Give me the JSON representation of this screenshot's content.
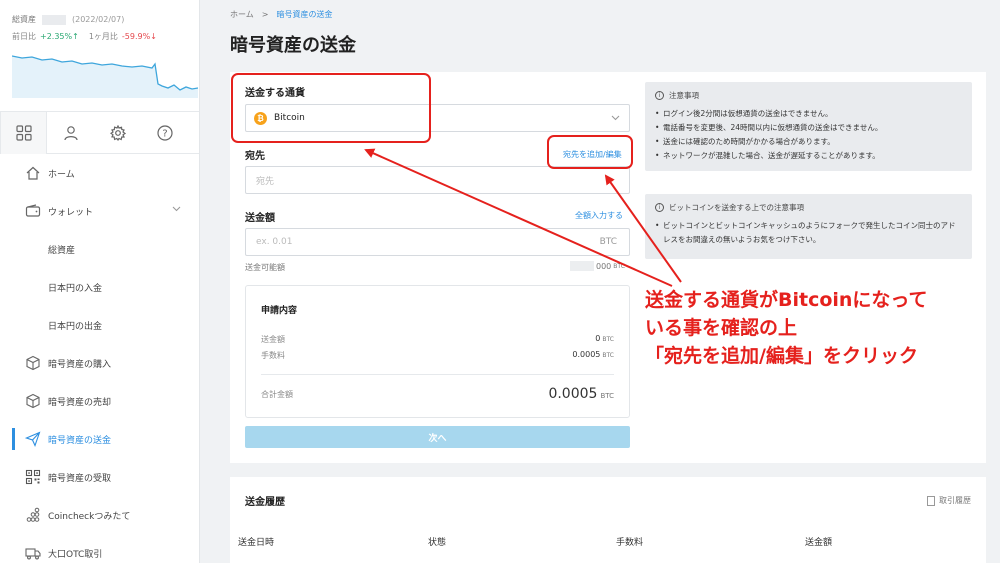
{
  "sidebar": {
    "asset_summary": {
      "total_label": "総資産",
      "date": "(2022/02/07)",
      "day_label": "前日比",
      "day_change": "+2.35%↑",
      "month_label": "1ヶ月比",
      "month_change": "-59.9%↓"
    },
    "icon_tabs": [
      "grid-icon",
      "user-icon",
      "gear-icon",
      "help-icon"
    ],
    "nav": [
      {
        "label": "ホーム",
        "icon": "home-icon"
      },
      {
        "label": "ウォレット",
        "icon": "wallet-icon"
      },
      {
        "label": "総資産"
      },
      {
        "label": "日本円の入金"
      },
      {
        "label": "日本円の出金"
      },
      {
        "label": "暗号資産の購入",
        "icon": "cube-icon"
      },
      {
        "label": "暗号資産の売却",
        "icon": "cube-icon"
      },
      {
        "label": "暗号資産の送金",
        "icon": "send-icon"
      },
      {
        "label": "暗号資産の受取",
        "icon": "qr-icon"
      },
      {
        "label": "Coincheckつみたて",
        "icon": "dots-icon"
      },
      {
        "label": "大口OTC取引",
        "icon": "truck-icon"
      }
    ]
  },
  "breadcrumb": {
    "home": "ホーム",
    "sep": ">",
    "current": "暗号資産の送金"
  },
  "page_title": "暗号資産の送金",
  "form": {
    "currency_label": "送金する通貨",
    "currency_value": "Bitcoin",
    "coin_symbol": "₿",
    "dest_label": "宛先",
    "dest_link": "宛先を追加/編集",
    "dest_placeholder": "宛先",
    "amount_label": "送金額",
    "amount_link": "全額入力する",
    "amount_placeholder": "ex. 0.01",
    "amount_unit": "BTC",
    "available_label": "送金可能額",
    "available_partial": "000",
    "available_unit": "BTC"
  },
  "summary": {
    "title": "申請内容",
    "send_label": "送金額",
    "send_value": "0",
    "fee_label": "手数料",
    "fee_value": "0.0005",
    "total_label": "合計金額",
    "total_value": "0.0005",
    "unit": "BTC"
  },
  "next_button": "次へ",
  "notes": {
    "title": "注意事項",
    "items": [
      "ログイン後2分間は仮想通貨の送金はできません。",
      "電話番号を変更後、24時間以内に仮想通貨の送金はできません。",
      "送金には確認のため時間がかかる場合があります。",
      "ネットワークが混雑した場合、送金が遅延することがあります。"
    ]
  },
  "btc_notes": {
    "title": "ビットコインを送金する上での注意事項",
    "items": [
      "ビットコインとビットコインキャッシュのようにフォークで発生したコイン同士のアドレスをお間違えの無いようお気をつけ下さい。"
    ]
  },
  "history": {
    "title": "送金履歴",
    "link": "取引履歴",
    "columns": [
      "送金日時",
      "状態",
      "手数料",
      "送金額"
    ]
  },
  "annotation": {
    "lines": [
      "送金する通貨がBitcoinになって",
      "いる事を確認の上",
      "「宛先を追加/編集」をクリック"
    ]
  },
  "colors": {
    "accent": "#2d8fe0",
    "annotation": "#e5211d",
    "bitcoin": "#f7a21b",
    "positive": "#2aa873",
    "negative": "#e5484d"
  }
}
